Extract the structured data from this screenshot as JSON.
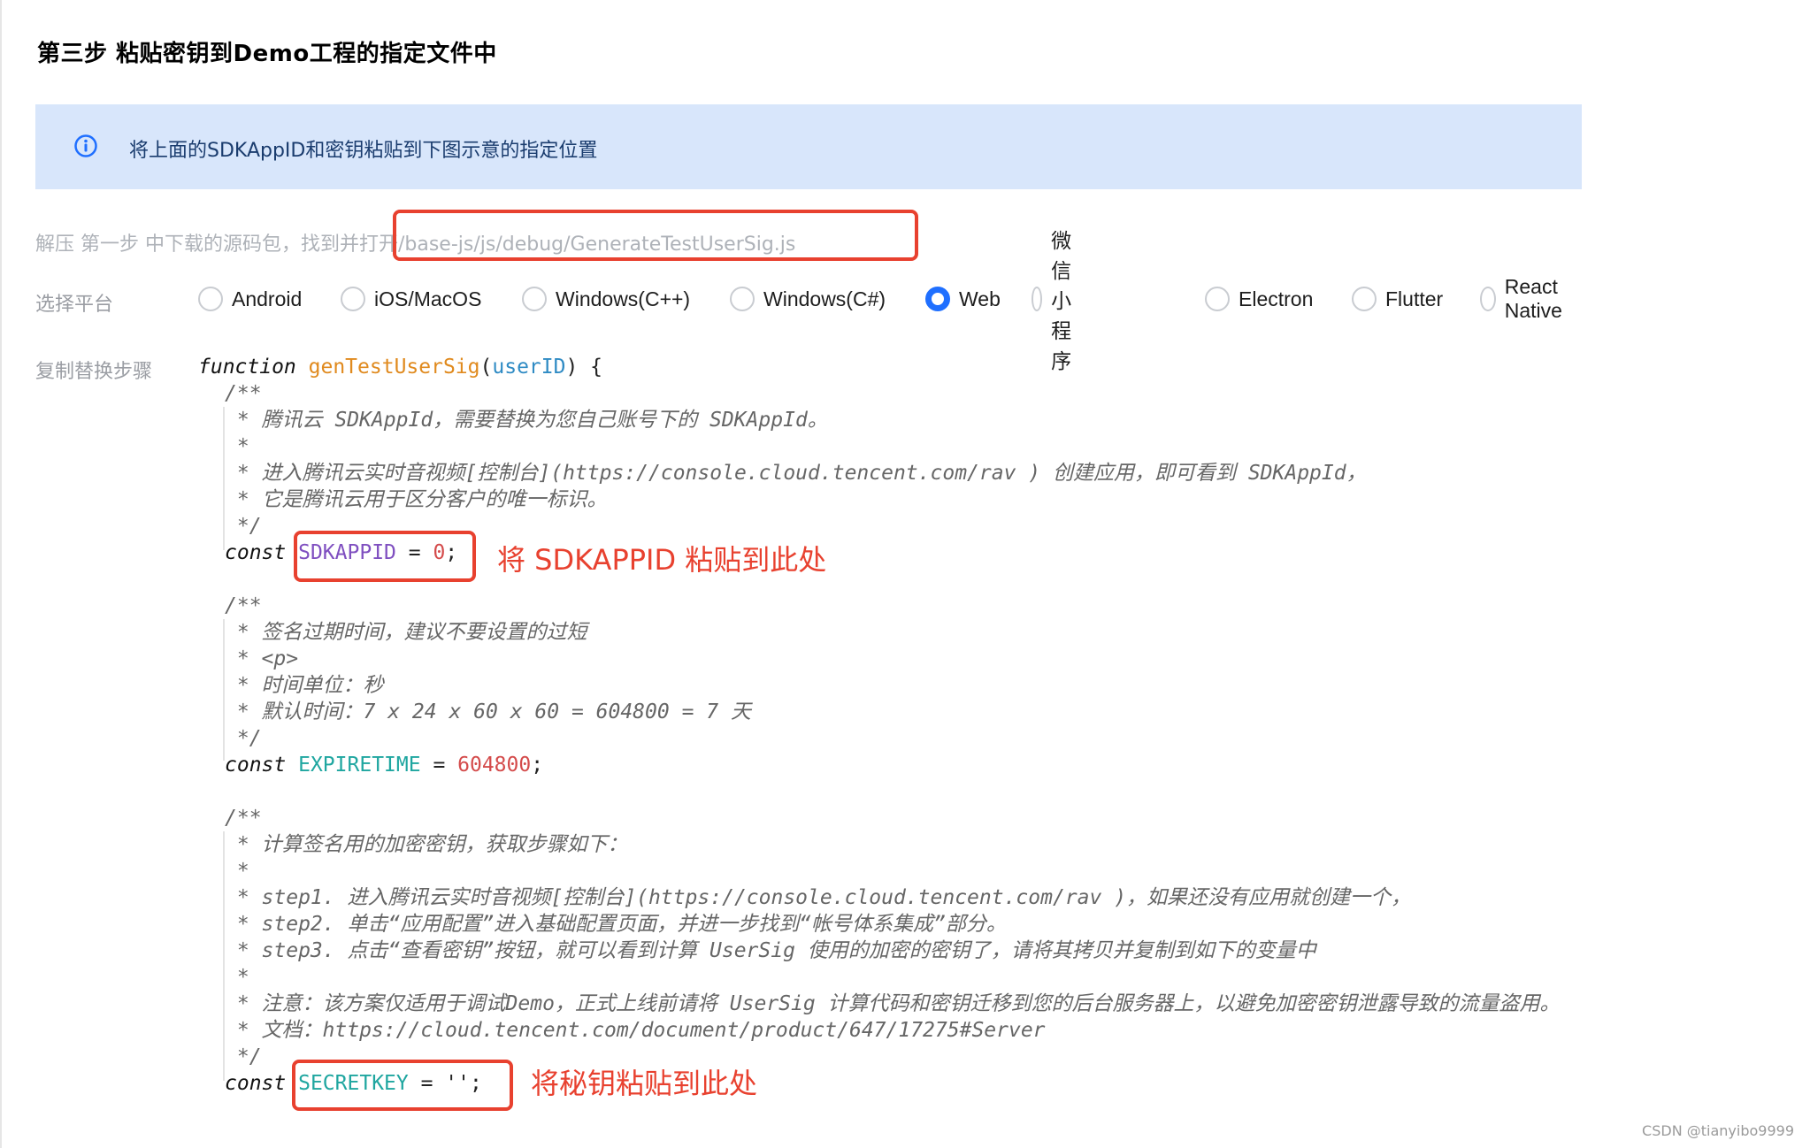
{
  "page": {
    "title": "第三步 粘贴密钥到Demo工程的指定文件中",
    "info_text": "将上面的SDKAppID和密钥粘贴到下图示意的指定位置",
    "hint_text": "解压 第一步 中下载的源码包，找到并打开/base-js/js/debug/GenerateTestUserSig.js",
    "platform_label": "选择平台",
    "copy_label": "复制替换步骤",
    "watermark": "CSDN @tianyibo9999"
  },
  "platforms": [
    {
      "label": "Android",
      "checked": false
    },
    {
      "label": "iOS/MacOS",
      "checked": false
    },
    {
      "label": "Windows(C++)",
      "checked": false
    },
    {
      "label": "Windows(C#)",
      "checked": false
    },
    {
      "label": "Web",
      "checked": true
    },
    {
      "label": "微信小程序",
      "checked": false
    },
    {
      "label": "Electron",
      "checked": false
    },
    {
      "label": "Flutter",
      "checked": false
    },
    {
      "label": "React Native",
      "checked": false
    }
  ],
  "code": {
    "fn_keyword": "function",
    "fn_name": "genTestUserSig",
    "fn_param": "userID",
    "fn_open": ") {",
    "c1_open": "/**",
    "c1_l1": " * 腾讯云 SDKAppId，需要替换为您自己账号下的 SDKAppId。",
    "c1_l2": " *",
    "c1_l3": " * 进入腾讯云实时音视频[控制台](https://console.cloud.tencent.com/rav ) 创建应用，即可看到 SDKAppId，",
    "c1_l4": " * 它是腾讯云用于区分客户的唯一标识。",
    "c1_close": " */",
    "const_kw": "const",
    "sdkappid_name": "SDKAPPID",
    "sdkappid_eq": " = ",
    "sdkappid_val": "0",
    "semi": ";",
    "note_sdkappid": "将 SDKAPPID 粘贴到此处",
    "c2_open": "/**",
    "c2_l1": " * 签名过期时间，建议不要设置的过短",
    "c2_l2": " * <p>",
    "c2_l3": " * 时间单位：秒",
    "c2_l4": " * 默认时间：7 x 24 x 60 x 60 = 604800 = 7 天",
    "c2_close": " */",
    "expire_name": "EXPIRETIME",
    "expire_eq": " = ",
    "expire_val": "604800",
    "c3_open": "/**",
    "c3_l1": " * 计算签名用的加密密钥，获取步骤如下：",
    "c3_l2": " *",
    "c3_l3": " * step1. 进入腾讯云实时音视频[控制台](https://console.cloud.tencent.com/rav )，如果还没有应用就创建一个，",
    "c3_l4": " * step2. 单击“应用配置”进入基础配置页面，并进一步找到“帐号体系集成”部分。",
    "c3_l5": " * step3. 点击“查看密钥”按钮，就可以看到计算 UserSig 使用的加密的密钥了，请将其拷贝并复制到如下的变量中",
    "c3_l6": " *",
    "c3_l7": " * 注意：该方案仅适用于调试Demo，正式上线前请将 UserSig 计算代码和密钥迁移到您的后台服务器上，以避免加密密钥泄露导致的流量盗用。",
    "c3_l8": " * 文档：https://cloud.tencent.com/document/product/647/17275#Server",
    "c3_close": " */",
    "secret_name": "SECRETKEY",
    "secret_eq": " = ",
    "secret_val": "''",
    "note_secret": "将秘钥粘贴到此处"
  },
  "colors": {
    "accent": "#1f6fff",
    "annotation_red": "#e8412f",
    "banner_bg": "#d8e6fb"
  }
}
